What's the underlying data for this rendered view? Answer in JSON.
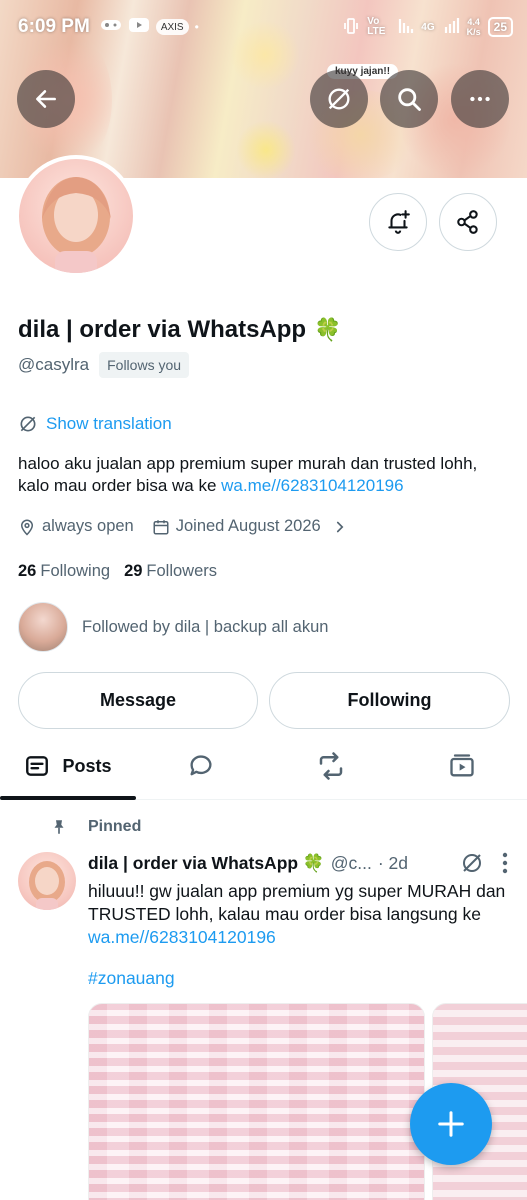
{
  "status_bar": {
    "time": "6:09 PM",
    "chip_label": "AXIS",
    "network": "Vo LTE",
    "signal_type": "4G",
    "speed": "4.4",
    "speed_unit": "K/s",
    "battery": "25"
  },
  "banner": {
    "sticker_text": "kuyy jajan!!"
  },
  "profile": {
    "display_name": "dila | order via WhatsApp",
    "name_emoji": "🍀",
    "handle": "@casylra",
    "follows_you": "Follows you",
    "show_translation": "Show translation",
    "bio_text": "haloo aku jualan app premium super murah dan trusted lohh, kalo mau order bisa wa ke ",
    "bio_link": "wa.me//6283104120196",
    "location": "always open",
    "joined": "Joined August 2026",
    "following_count": "26",
    "following_label": "Following",
    "followers_count": "29",
    "followers_label": "Followers",
    "followed_by": "Followed by dila | backup all akun"
  },
  "actions": {
    "message_label": "Message",
    "following_label": "Following"
  },
  "tabs": [
    {
      "label": "Posts",
      "icon": "posts-icon",
      "active": true
    },
    {
      "label": "",
      "icon": "replies-icon"
    },
    {
      "label": "",
      "icon": "reposts-icon"
    },
    {
      "label": "",
      "icon": "media-icon"
    }
  ],
  "pinned_post": {
    "pinned_label": "Pinned",
    "author_name": "dila | order via WhatsApp 🍀",
    "author_handle": "@c...",
    "time": "· 2d",
    "text_before_link": "hiluuu!! gw jualan app premium yg super MURAH dan TRUSTED lohh, kalau mau order bisa langsung ke ",
    "link": "wa.me//6283104120196",
    "hashtag": "#zonauang"
  },
  "colors": {
    "accent": "#1d9bf0",
    "text_primary": "#0f1419",
    "text_secondary": "#536471",
    "border": "#cfd9de"
  }
}
